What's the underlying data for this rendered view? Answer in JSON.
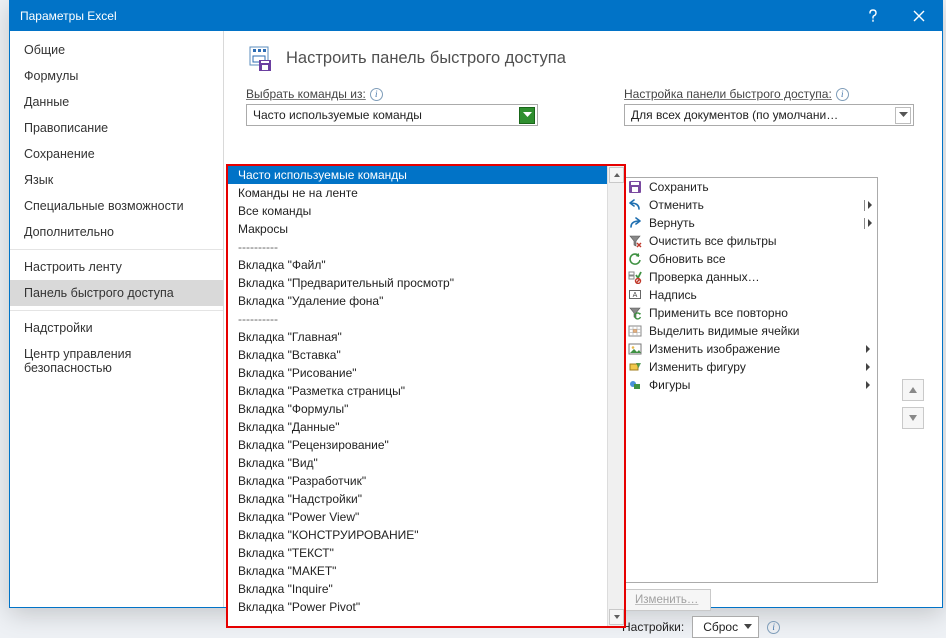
{
  "window": {
    "title": "Параметры Excel"
  },
  "sidebar": {
    "items": [
      {
        "label": "Общие"
      },
      {
        "label": "Формулы"
      },
      {
        "label": "Данные"
      },
      {
        "label": "Правописание"
      },
      {
        "label": "Сохранение"
      },
      {
        "label": "Язык"
      },
      {
        "label": "Специальные возможности"
      },
      {
        "label": "Дополнительно"
      }
    ],
    "items2": [
      {
        "label": "Настроить ленту"
      },
      {
        "label": "Панель быстрого доступа",
        "selected": true
      }
    ],
    "items3": [
      {
        "label": "Надстройки"
      },
      {
        "label": "Центр управления безопасностью"
      }
    ]
  },
  "header": {
    "title": "Настроить панель быстрого доступа"
  },
  "leftCombo": {
    "label": "Выбрать команды из:",
    "value": "Часто используемые команды"
  },
  "rightCombo": {
    "label": "Настройка панели быстрого доступа:",
    "value": "Для всех документов (по умолчани…"
  },
  "dropdown": {
    "items": [
      {
        "label": "Часто используемые команды",
        "selected": true
      },
      {
        "label": "Команды не на ленте"
      },
      {
        "label": "Все команды"
      },
      {
        "label": "Макросы"
      },
      {
        "label": "----------",
        "sep": true
      },
      {
        "label": "Вкладка \"Файл\""
      },
      {
        "label": "Вкладка \"Предварительный просмотр\""
      },
      {
        "label": "Вкладка \"Удаление фона\""
      },
      {
        "label": "----------",
        "sep": true
      },
      {
        "label": "Вкладка \"Главная\""
      },
      {
        "label": "Вкладка \"Вставка\""
      },
      {
        "label": "Вкладка \"Рисование\""
      },
      {
        "label": "Вкладка \"Разметка страницы\""
      },
      {
        "label": "Вкладка \"Формулы\""
      },
      {
        "label": "Вкладка \"Данные\""
      },
      {
        "label": "Вкладка \"Рецензирование\""
      },
      {
        "label": "Вкладка \"Вид\""
      },
      {
        "label": "Вкладка \"Разработчик\""
      },
      {
        "label": "Вкладка \"Надстройки\""
      },
      {
        "label": "Вкладка \"Power View\""
      },
      {
        "label": "Вкладка \"КОНСТРУИРОВАНИЕ\""
      },
      {
        "label": "Вкладка \"ТЕКСТ\""
      },
      {
        "label": "Вкладка \"МАКЕТ\""
      },
      {
        "label": "Вкладка \"Inquire\""
      },
      {
        "label": "Вкладка \"Power Pivot\""
      }
    ]
  },
  "qat": {
    "items": [
      {
        "icon": "save",
        "label": "Сохранить"
      },
      {
        "icon": "undo",
        "label": "Отменить",
        "arrow": "bar"
      },
      {
        "icon": "redo",
        "label": "Вернуть",
        "arrow": "bar"
      },
      {
        "icon": "clear-filters",
        "label": "Очистить все фильтры"
      },
      {
        "icon": "refresh",
        "label": "Обновить все"
      },
      {
        "icon": "data-validation",
        "label": "Проверка данных…"
      },
      {
        "icon": "textbox",
        "label": "Надпись"
      },
      {
        "icon": "repeat",
        "label": "Применить все повторно"
      },
      {
        "icon": "visible-cells",
        "label": "Выделить видимые ячейки"
      },
      {
        "icon": "image",
        "label": "Изменить изображение",
        "arrow": true
      },
      {
        "icon": "shape",
        "label": "Изменить фигуру",
        "arrow": true
      },
      {
        "icon": "shapes",
        "label": "Фигуры",
        "arrow": true
      }
    ]
  },
  "modify": {
    "label": "Изменить…"
  },
  "reset": {
    "label": "Настройки:",
    "button": "Сброс"
  }
}
